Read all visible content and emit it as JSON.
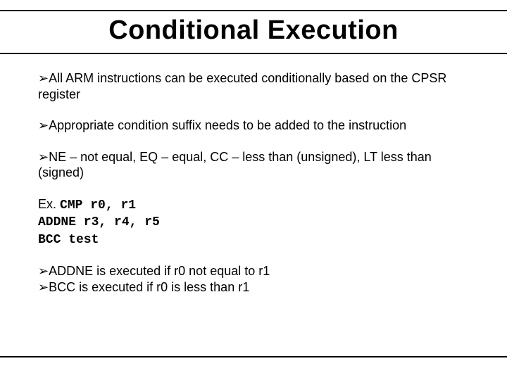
{
  "title": "Conditional Execution",
  "bullet_char": "➢",
  "bullets": {
    "b1": "All ARM instructions can be executed conditionally based on the CPSR register",
    "b2": "Appropriate condition suffix needs to be added to the instruction",
    "b3": "NE – not equal, EQ – equal, CC – less than (unsigned), LT less than (signed)",
    "b4": "ADDNE is executed if r0 not equal to r1",
    "b5": "BCC is executed if r0 is less than r1"
  },
  "example": {
    "label": "Ex.",
    "line1": "CMP r0, r1",
    "line2": "ADDNE r3, r4, r5",
    "line3": "BCC test"
  }
}
